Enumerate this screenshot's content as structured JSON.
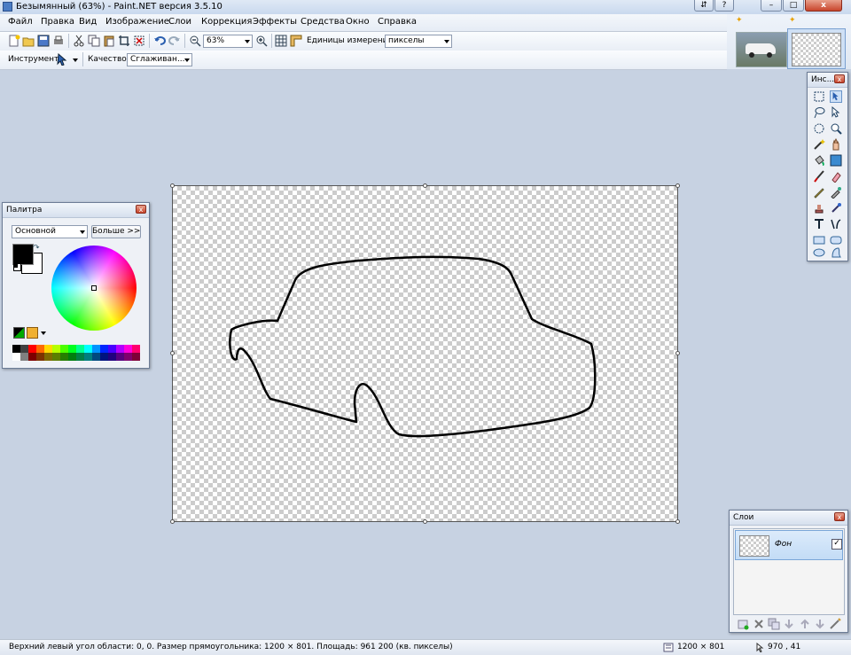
{
  "window": {
    "title": "Безымянный (63%) - Paint.NET версия 3.5.10"
  },
  "menu": {
    "items": [
      "Файл",
      "Правка",
      "Вид",
      "Изображение",
      "Слои",
      "Коррекция",
      "Эффекты",
      "Средства",
      "Окно",
      "Справка"
    ]
  },
  "toolbar": {
    "zoom_value": "63%",
    "units_label": "Единицы измерения:",
    "units_value": "пикселы",
    "tool_label": "Инструмент:",
    "quality_label": "Качество:",
    "quality_value": "Сглаживан..."
  },
  "palette": {
    "title": "Палитра",
    "mode_value": "Основной",
    "more_button": "Больше >>",
    "primary_color": "#000000",
    "secondary_color": "#ffffff",
    "swatches_row1": [
      "#000000",
      "#404040",
      "#ff0000",
      "#ff6a00",
      "#ffd800",
      "#b6ff00",
      "#4cff00",
      "#00ff21",
      "#00ff90",
      "#00ffff",
      "#0094ff",
      "#0026ff",
      "#4800ff",
      "#b200ff",
      "#ff00dc",
      "#ff006e"
    ],
    "swatches_row2": [
      "#ffffff",
      "#808080",
      "#7f0000",
      "#7f3300",
      "#7f6a00",
      "#5b7f00",
      "#267f00",
      "#007f0e",
      "#007f46",
      "#007f7f",
      "#004a7f",
      "#00137f",
      "#21007f",
      "#57007f",
      "#7f006e",
      "#7f0037"
    ]
  },
  "tools": {
    "title": "Инс..."
  },
  "layers": {
    "title": "Слои",
    "items": [
      {
        "name": "Фон",
        "visible": true
      }
    ]
  },
  "status": {
    "info": "Верхний левый угол области: 0, 0. Размер прямоугольника: 1200 × 801. Площадь: 961 200 (кв. пикселы)",
    "image_size": "1200 × 801",
    "cursor_pos": "970 , 41"
  },
  "colors": {
    "accent": "#3a6ea5",
    "workspace": "#c7d2e2",
    "layer_selected": "#cfe3f7"
  }
}
